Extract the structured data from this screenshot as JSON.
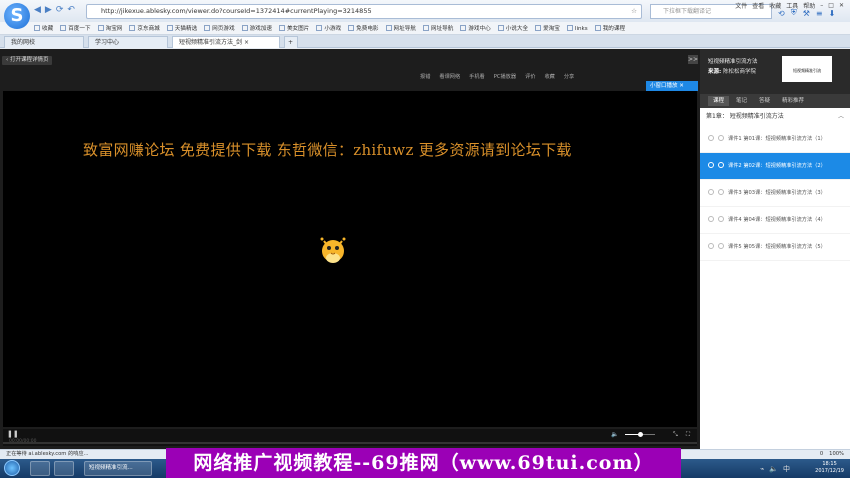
{
  "browser": {
    "url": "http://jikexue.ablesky.com/viewer.do?courseId=1372414#currentPlaying=3214855",
    "search_placeholder": "下拉框下载翻译记",
    "menu": [
      "文件",
      "查看",
      "收藏",
      "工具",
      "帮助"
    ],
    "nav_icons": [
      "back-icon",
      "forward-icon",
      "refresh-icon",
      "home-icon"
    ]
  },
  "bookmarks": [
    "收藏",
    "百度一下",
    "淘宝网",
    "京东商城",
    "天猫精选",
    "网页游戏",
    "游戏加速",
    "美女图片",
    "小游戏",
    "免费电影",
    "网址导航",
    "网址导航",
    "游戏中心",
    "小说大全",
    "爱淘宝",
    "links",
    "我的课程"
  ],
  "tabs": [
    {
      "label": "我的网校",
      "active": false
    },
    {
      "label": "学习中心",
      "active": false
    },
    {
      "label": "短视频精准引流方法_剑",
      "active": true
    }
  ],
  "player": {
    "back_label": "打开课程详情页",
    "expand_label": ">>",
    "tools": [
      "报错",
      "看课网络",
      "手机看",
      "PC播放器",
      "评价",
      "收藏",
      "分享"
    ],
    "mini_label": "小窗口播放",
    "watermark": "致富网赚论坛 免费提供下载 东哲微信：zhifuwz 更多资源请到论坛下载",
    "timecode": "00:00/00:00",
    "volume_percent": 45
  },
  "sidebar": {
    "course_title": "短视频精准引流方法",
    "source_label": "来源:",
    "source_value": "陈松松商学院",
    "thumb_text": "短视频精准引流",
    "tabs": [
      {
        "label": "课程",
        "active": true
      },
      {
        "label": "笔记",
        "active": false
      },
      {
        "label": "答疑",
        "active": false
      },
      {
        "label": "精彩推荐",
        "active": false
      }
    ],
    "chapter": "第1章：  短视频精准引流方法",
    "lessons": [
      {
        "label": "课件1 第01课：短视频精准引流方法（1）",
        "active": false
      },
      {
        "label": "课件2 第02课：短视频精准引流方法（2）",
        "active": true
      },
      {
        "label": "课件3 第03课：短视频精准引流方法（3）",
        "active": false
      },
      {
        "label": "课件4 第04课：短视频精准引流方法（4）",
        "active": false
      },
      {
        "label": "课件5 第05课：短视频精准引流方法（5）",
        "active": false
      }
    ]
  },
  "status": {
    "left": "正在等待 ai.ablesky.com 的响应...",
    "right": [
      "0",
      "100%"
    ]
  },
  "taskbar": {
    "items": [
      "短视频精准引流..."
    ],
    "time": "18:15",
    "date": "2017/12/19"
  },
  "banner": "网络推广视频教程--69推网（www.69tui.com）"
}
